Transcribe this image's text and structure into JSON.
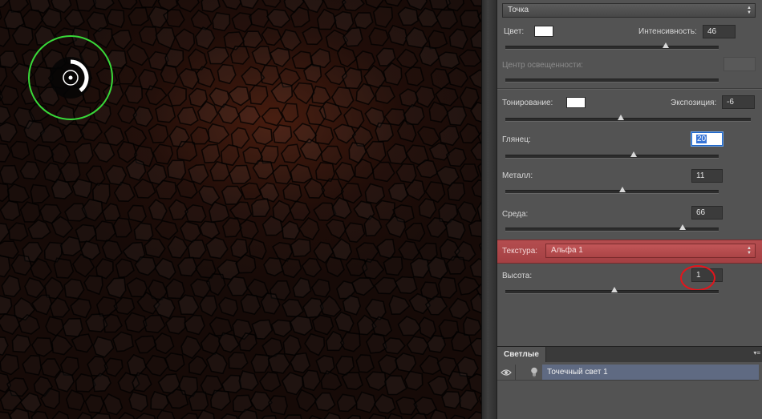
{
  "light_type": {
    "selected": "Точка"
  },
  "light_settings": {
    "color_label": "Цвет:",
    "intensity_label": "Интенсивность:",
    "intensity_value": "46",
    "intensity_level": 0.75,
    "hotspot_label": "Центр освещенности:"
  },
  "properties": {
    "gloss_label": "Тонирование:",
    "exposure_label": "Экспозиция:",
    "exposure_value": "-6",
    "exposure_level": 0.47,
    "shine_label": "Глянец:",
    "shine_value": "20",
    "shine_level": 0.6,
    "metallic_label": "Металл:",
    "metallic_value": "11",
    "metallic_level": 0.55,
    "ambience_label": "Среда:",
    "ambience_value": "66",
    "ambience_level": 0.83
  },
  "texture": {
    "label": "Текстура:",
    "channel": "Альфа 1",
    "height_label": "Высота:",
    "height_value": "1",
    "height_level": 0.51
  },
  "lights_panel": {
    "tab_label": "Светлые",
    "items": [
      {
        "name": "Точечный свет 1"
      }
    ]
  },
  "colors": {
    "texture_highlight": "#b44d4f",
    "annotation_circle": "#e4141b",
    "light_handle": "#39d939",
    "selected_light_row": "#5f6a82"
  }
}
